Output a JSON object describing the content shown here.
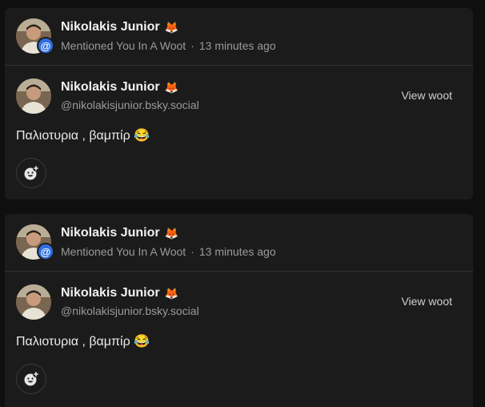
{
  "notifications": [
    {
      "author": "Nikolakis Junior",
      "author_emoji": "🦊",
      "action": "Mentioned You In A Woot",
      "separator": "·",
      "time": "13 minutes ago",
      "badge": "@",
      "post": {
        "author": "Nikolakis Junior",
        "author_emoji": "🦊",
        "handle": "@nikolakisjunior.bsky.social",
        "view_label": "View woot",
        "text": "Παλιοτυρια , βαμπίρ 😂"
      }
    },
    {
      "author": "Nikolakis Junior",
      "author_emoji": "🦊",
      "action": "Mentioned You In A Woot",
      "separator": "·",
      "time": "13 minutes ago",
      "badge": "@",
      "post": {
        "author": "Nikolakis Junior",
        "author_emoji": "🦊",
        "handle": "@nikolakisjunior.bsky.social",
        "view_label": "View woot",
        "text": "Παλιοτυρια , βαμπίρ 😂"
      }
    }
  ],
  "icons": {
    "badge": "at-sign-icon",
    "reaction": "add-reaction-icon"
  },
  "colors": {
    "background": "#0f0f0f",
    "card": "#1b1b1b",
    "badge": "#2f6fdf",
    "muted_text": "#9a9a9a"
  }
}
